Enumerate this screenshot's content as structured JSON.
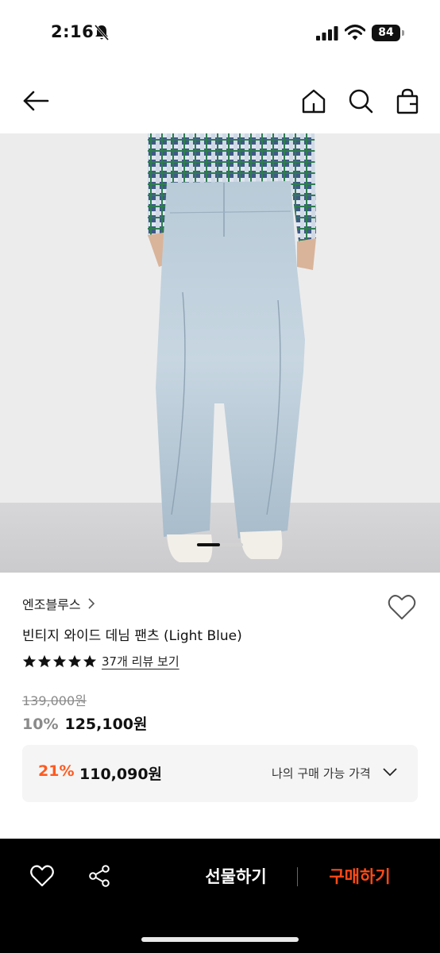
{
  "status_bar": {
    "time": "2:16",
    "battery": "84"
  },
  "nav": {
    "back_icon": "arrow-left-icon",
    "home_icon": "home-icon",
    "search_icon": "search-icon",
    "bag_icon": "shopping-bag-icon"
  },
  "product": {
    "image_icon": "product-photo",
    "brand": "엔조블루스",
    "title": "빈티지 와이드 데님 팬츠 (Light Blue)",
    "rating": 5,
    "review_link": "37개 리뷰 보기",
    "original_price": "139,000원",
    "discount": "10%",
    "sale_price": "125,100원",
    "carousel_progress": 0.5
  },
  "my_price": {
    "discount": "21%",
    "price": "110,090원",
    "label": "나의 구매 가능 가격"
  },
  "bottom_bar": {
    "gift_label": "선물하기",
    "buy_label": "구매하기"
  },
  "colors": {
    "accent": "#ff5a1f",
    "buy": "#ff4a17",
    "bottom_bar": "#000000"
  }
}
